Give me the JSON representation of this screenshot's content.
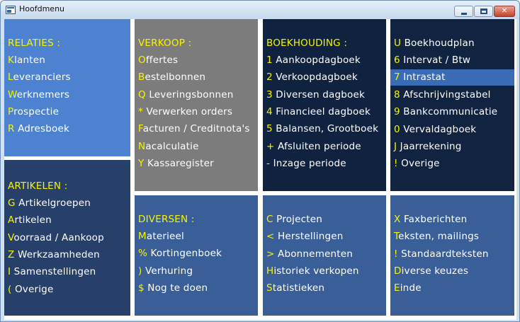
{
  "window": {
    "title": "Hoofdmenu"
  },
  "colors": {
    "relaties_bg": "#4c82d0",
    "artikelen_bg": "#27406a",
    "verkoop_bg": "#7c7c7c",
    "boekhouding_bg": "#0f2341",
    "boekhoud2_bg": "#102442",
    "lower_bg": "#3a5f98",
    "hotkey": "#f7f400",
    "text": "#ffffff",
    "selected": "#3a6bb5"
  },
  "panels": {
    "relaties": {
      "heading": "RELATIES :",
      "items": [
        {
          "key": "K",
          "rest": "lanten"
        },
        {
          "key": "L",
          "rest": "everanciers"
        },
        {
          "key": "W",
          "rest": "erknemers"
        },
        {
          "key": "P",
          "rest": "rospectie"
        },
        {
          "key": "R",
          "rest": " Adresboek"
        }
      ]
    },
    "artikelen": {
      "heading": "ARTIKELEN :",
      "items": [
        {
          "key": "G",
          "rest": " Artikelgroepen"
        },
        {
          "key": "A",
          "rest": "rtikelen"
        },
        {
          "key": "V",
          "rest": "oorraad / Aankoop"
        },
        {
          "key": "Z",
          "rest": " Werkzaamheden"
        },
        {
          "key": "I",
          "rest": " Samenstellingen"
        },
        {
          "key": "(",
          "rest": " Overige"
        }
      ]
    },
    "verkoop": {
      "heading": "VERKOOP :",
      "items": [
        {
          "key": "O",
          "rest": "ffertes"
        },
        {
          "key": "B",
          "rest": "estelbonnen"
        },
        {
          "key": "Q",
          "rest": " Leveringsbonnen"
        },
        {
          "key": "*",
          "rest": " Verwerken orders"
        },
        {
          "key": "F",
          "rest": "acturen / Creditnota's"
        },
        {
          "key": "N",
          "rest": "acalculatie"
        },
        {
          "key": "Y",
          "rest": " Kassaregister"
        }
      ]
    },
    "diversen": {
      "heading": "DIVERSEN :",
      "items": [
        {
          "key": "M",
          "rest": "aterieel"
        },
        {
          "key": "%",
          "rest": " Kortingenboek"
        },
        {
          "key": ")",
          "rest": " Verhuring"
        },
        {
          "key": "$",
          "rest": " Nog te doen"
        }
      ]
    },
    "boekhouding": {
      "heading": "BOEKHOUDING :",
      "items": [
        {
          "key": "1",
          "rest": " Aankoopdagboek"
        },
        {
          "key": "2",
          "rest": " Verkoopdagboek"
        },
        {
          "key": "3",
          "rest": " Diversen dagboek"
        },
        {
          "key": "4",
          "rest": " Financieel dagboek"
        },
        {
          "key": "5",
          "rest": " Balansen, Grootboek"
        },
        {
          "key": "+",
          "rest": " Afsluiten periode"
        },
        {
          "key": "-",
          "rest": " Inzage periode"
        }
      ]
    },
    "projecten": {
      "items": [
        {
          "key": "C",
          "rest": " Projecten"
        },
        {
          "key": "<",
          "rest": " Herstellingen"
        },
        {
          "key": ">",
          "rest": " Abonnementen"
        },
        {
          "key": "H",
          "rest": "istoriek verkopen"
        },
        {
          "key": "S",
          "rest": "tatistieken"
        }
      ]
    },
    "boekhoud2": {
      "items": [
        {
          "key": "U",
          "rest": " Boekhoudplan"
        },
        {
          "key": "6",
          "rest": " Intervat / Btw"
        },
        {
          "key": "7",
          "rest": " Intrastat"
        },
        {
          "key": "8",
          "rest": " Afschrijvingstabel"
        },
        {
          "key": "9",
          "rest": " Bankcommunicatie"
        },
        {
          "key": "0",
          "rest": " Vervaldagboek"
        },
        {
          "key": "J",
          "rest": " Jaarrekening"
        },
        {
          "key": "!",
          "rest": " Overige"
        }
      ]
    },
    "overig": {
      "items": [
        {
          "key": "X",
          "rest": " Faxberichten"
        },
        {
          "key": "T",
          "rest": "eksten, mailings"
        },
        {
          "key": "!",
          "rest": " Standaardteksten"
        },
        {
          "key": "D",
          "rest": "iverse keuzes"
        },
        {
          "key": "E",
          "rest": "inde"
        }
      ]
    }
  }
}
